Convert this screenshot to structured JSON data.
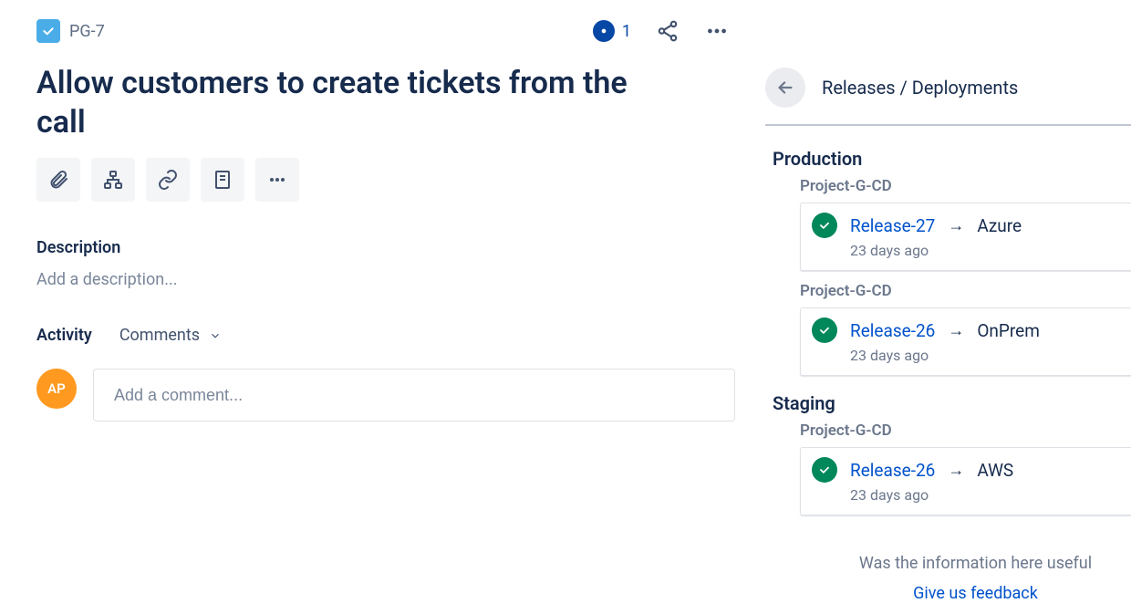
{
  "issue": {
    "key": "PG-7",
    "title": "Allow customers to create tickets from the call",
    "watch_count": "1"
  },
  "description": {
    "label": "Description",
    "placeholder": "Add a description..."
  },
  "activity": {
    "label": "Activity",
    "filter": "Comments",
    "comment_placeholder": "Add a comment...",
    "avatar_initials": "AP"
  },
  "panel": {
    "title": "Releases / Deployments",
    "groups": [
      {
        "name": "Production",
        "project": "Project-G-CD",
        "releases": [
          {
            "name": "Release-27",
            "target": "Azure",
            "time": "23 days ago"
          },
          {
            "name": "Release-26",
            "target": "OnPrem",
            "time": "23 days ago"
          }
        ]
      },
      {
        "name": "Staging",
        "project": "Project-G-CD",
        "releases": [
          {
            "name": "Release-26",
            "target": "AWS",
            "time": "23 days ago"
          }
        ]
      }
    ],
    "feedback_question": "Was the information here useful",
    "feedback_link": "Give us feedback"
  }
}
